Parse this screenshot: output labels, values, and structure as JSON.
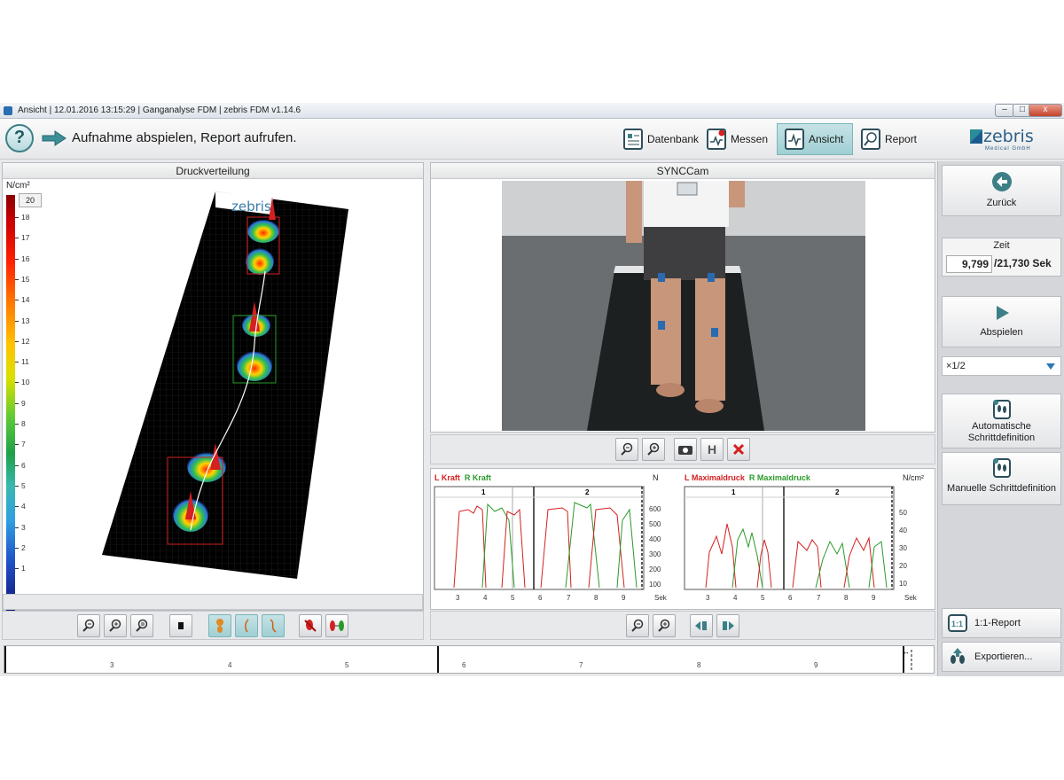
{
  "window": {
    "title": "Ansicht | 12.01.2016 13:15:29 | Ganganalyse FDM | zebris FDM v1.14.6",
    "controls": [
      "‒",
      "□",
      "x"
    ]
  },
  "toolbar": {
    "help": "?",
    "hint": "Aufnahme abspielen, Report aufrufen.",
    "nav": [
      {
        "label": "Datenbank",
        "icon": "database-icon"
      },
      {
        "label": "Messen",
        "icon": "measure-icon"
      },
      {
        "label": "Ansicht",
        "icon": "view-icon",
        "active": true
      },
      {
        "label": "Report",
        "icon": "report-icon"
      }
    ],
    "logo": {
      "text": "zebris",
      "sub": "Medical GmbH"
    }
  },
  "pressure": {
    "title": "Druckverteilung",
    "unit": "N/cm²",
    "max_value": "20",
    "scale_ticks": [
      "18",
      "17",
      "16",
      "15",
      "14",
      "13",
      "12",
      "11",
      "10",
      "9",
      "8",
      "7",
      "6",
      "5",
      "4",
      "3",
      "2",
      "1"
    ],
    "plate_logo": "zebris"
  },
  "camera": {
    "title": "SYNCCam"
  },
  "force_chart": {
    "legend_left": "L Kraft",
    "legend_right": "R Kraft",
    "unit": "N",
    "steps": [
      "1",
      "2"
    ],
    "y_ticks": [
      "600",
      "500",
      "400",
      "300",
      "200",
      "100"
    ],
    "x_ticks": [
      "3",
      "4",
      "5",
      "6",
      "7",
      "8",
      "9"
    ],
    "x_unit": "Sek"
  },
  "pressure_chart": {
    "legend_left": "L Maximaldruck",
    "legend_right": "R Maximaldruck",
    "unit": "N/cm²",
    "steps": [
      "1",
      "2"
    ],
    "y_ticks": [
      "50",
      "40",
      "30",
      "20",
      "10"
    ],
    "x_ticks": [
      "3",
      "4",
      "5",
      "6",
      "7",
      "8",
      "9"
    ],
    "x_unit": "Sek"
  },
  "timeline": {
    "ticks": [
      "3",
      "4",
      "5",
      "6",
      "7",
      "8",
      "9"
    ]
  },
  "sidebar": {
    "back": "Zurück",
    "time_label": "Zeit",
    "time_current": "9,799",
    "time_total": "/21,730 Sek",
    "play": "Abspielen",
    "speed": "×1/2",
    "auto_step": "Automatische Schrittdefinition",
    "manual_step": "Manuelle Schrittdefinition",
    "report_11": "1:1-Report",
    "export": "Exportieren..."
  },
  "colors": {
    "left": "#d42020",
    "right": "#2a9a2a",
    "accent": "#3d7f86"
  }
}
